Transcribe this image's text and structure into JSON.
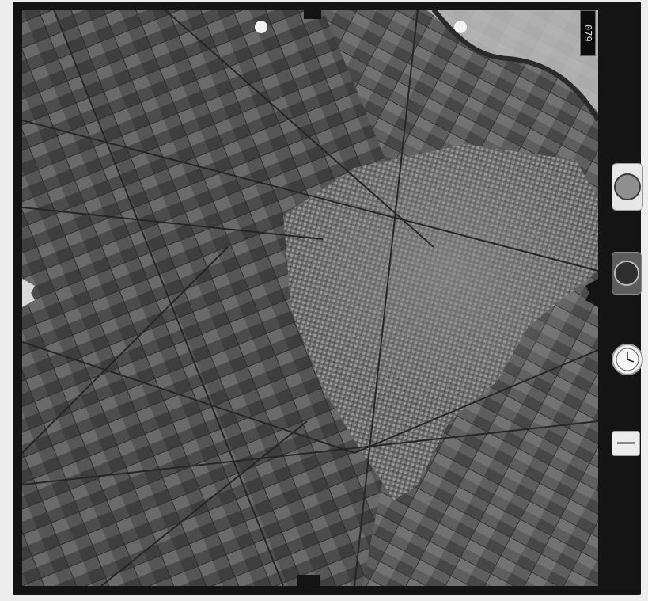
{
  "film": {
    "frame_number": "079"
  },
  "colors": {
    "frame": "#141414",
    "paper": "#ededed",
    "photo_base": "#4a4a4a",
    "urban": "#7d7d7d"
  },
  "instruments": {
    "icons": [
      "altimeter-icon",
      "level-bubble-icon",
      "clock-icon",
      "counter-icon"
    ]
  }
}
